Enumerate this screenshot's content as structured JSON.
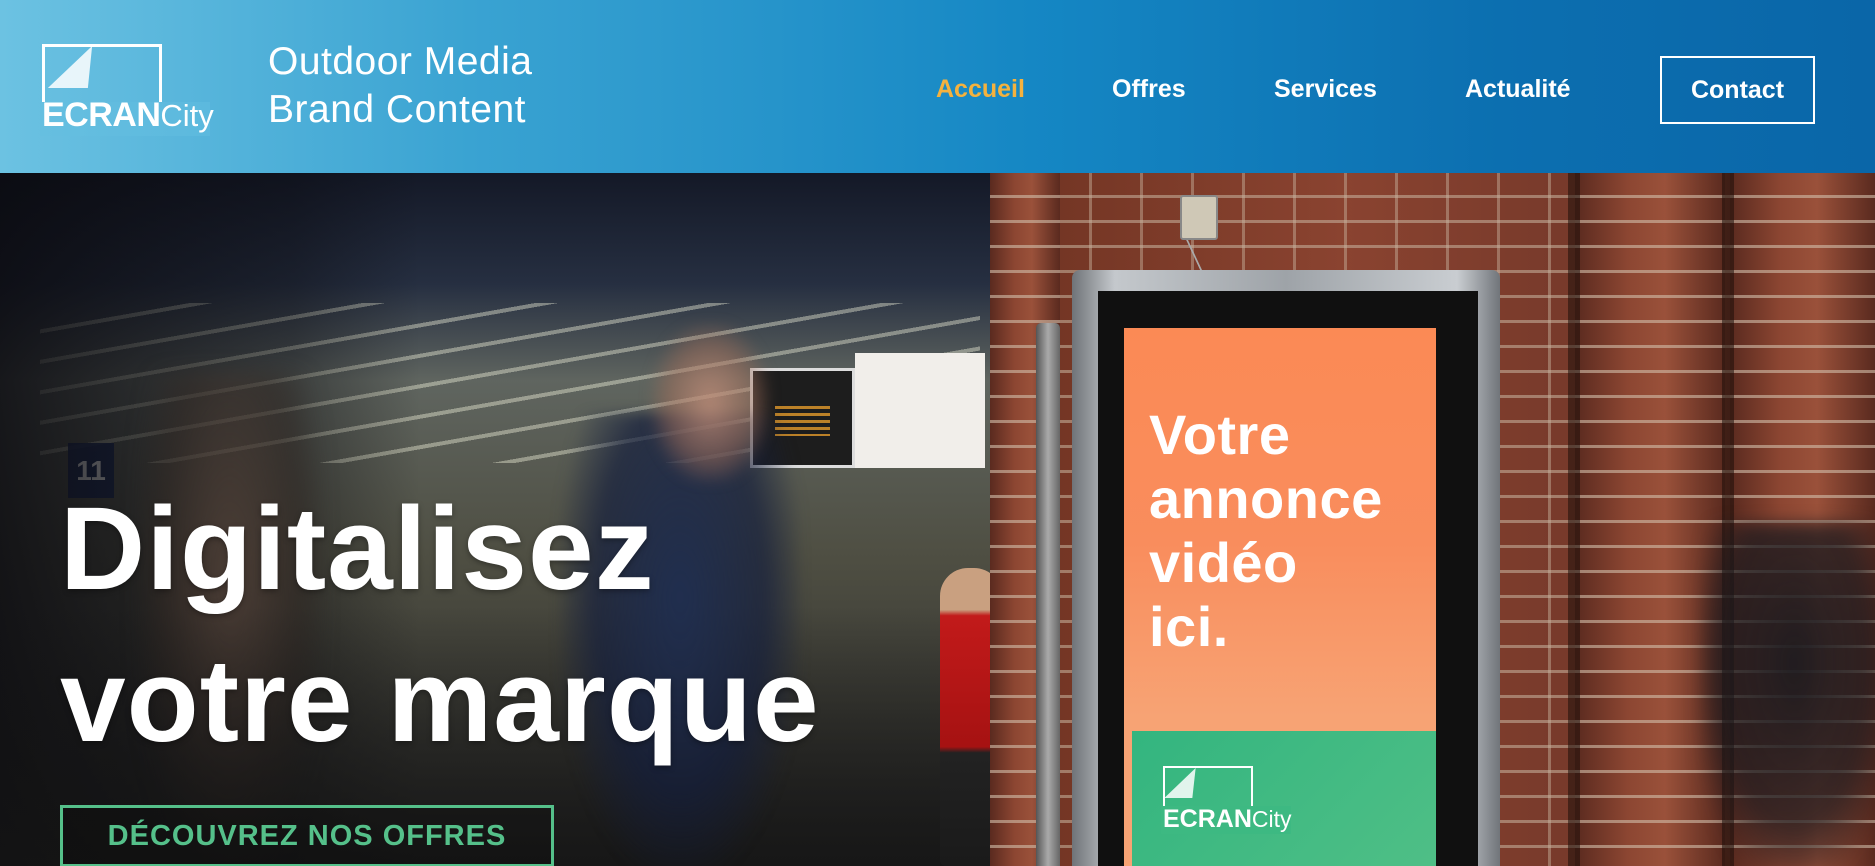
{
  "brand": {
    "logo_bold": "ECRAN",
    "logo_light": "City",
    "tagline_line1": "Outdoor Media",
    "tagline_line2": "Brand Content"
  },
  "nav": {
    "items": [
      {
        "label": "Accueil",
        "active": true
      },
      {
        "label": "Offres",
        "active": false
      },
      {
        "label": "Services",
        "active": false
      },
      {
        "label": "Actualité",
        "active": false
      }
    ],
    "contact_label": "Contact"
  },
  "hero": {
    "title_line1": "Digitalisez",
    "title_line2": "votre marque",
    "cta_label": "DÉCOUVREZ NOS OFFRES",
    "platform_number": "11",
    "ad": {
      "line1": "Votre",
      "line2": "annonce",
      "line3": "vidéo",
      "line4": "ici.",
      "logo_bold": "ECRAN",
      "logo_light": "City"
    }
  },
  "colors": {
    "header_start": "#6cc2e2",
    "header_end": "#0a66a8",
    "nav_active": "#f4b23e",
    "cta_green": "#55c08a",
    "ad_orange": "#fb8a55",
    "ad_green": "#33b57f"
  }
}
